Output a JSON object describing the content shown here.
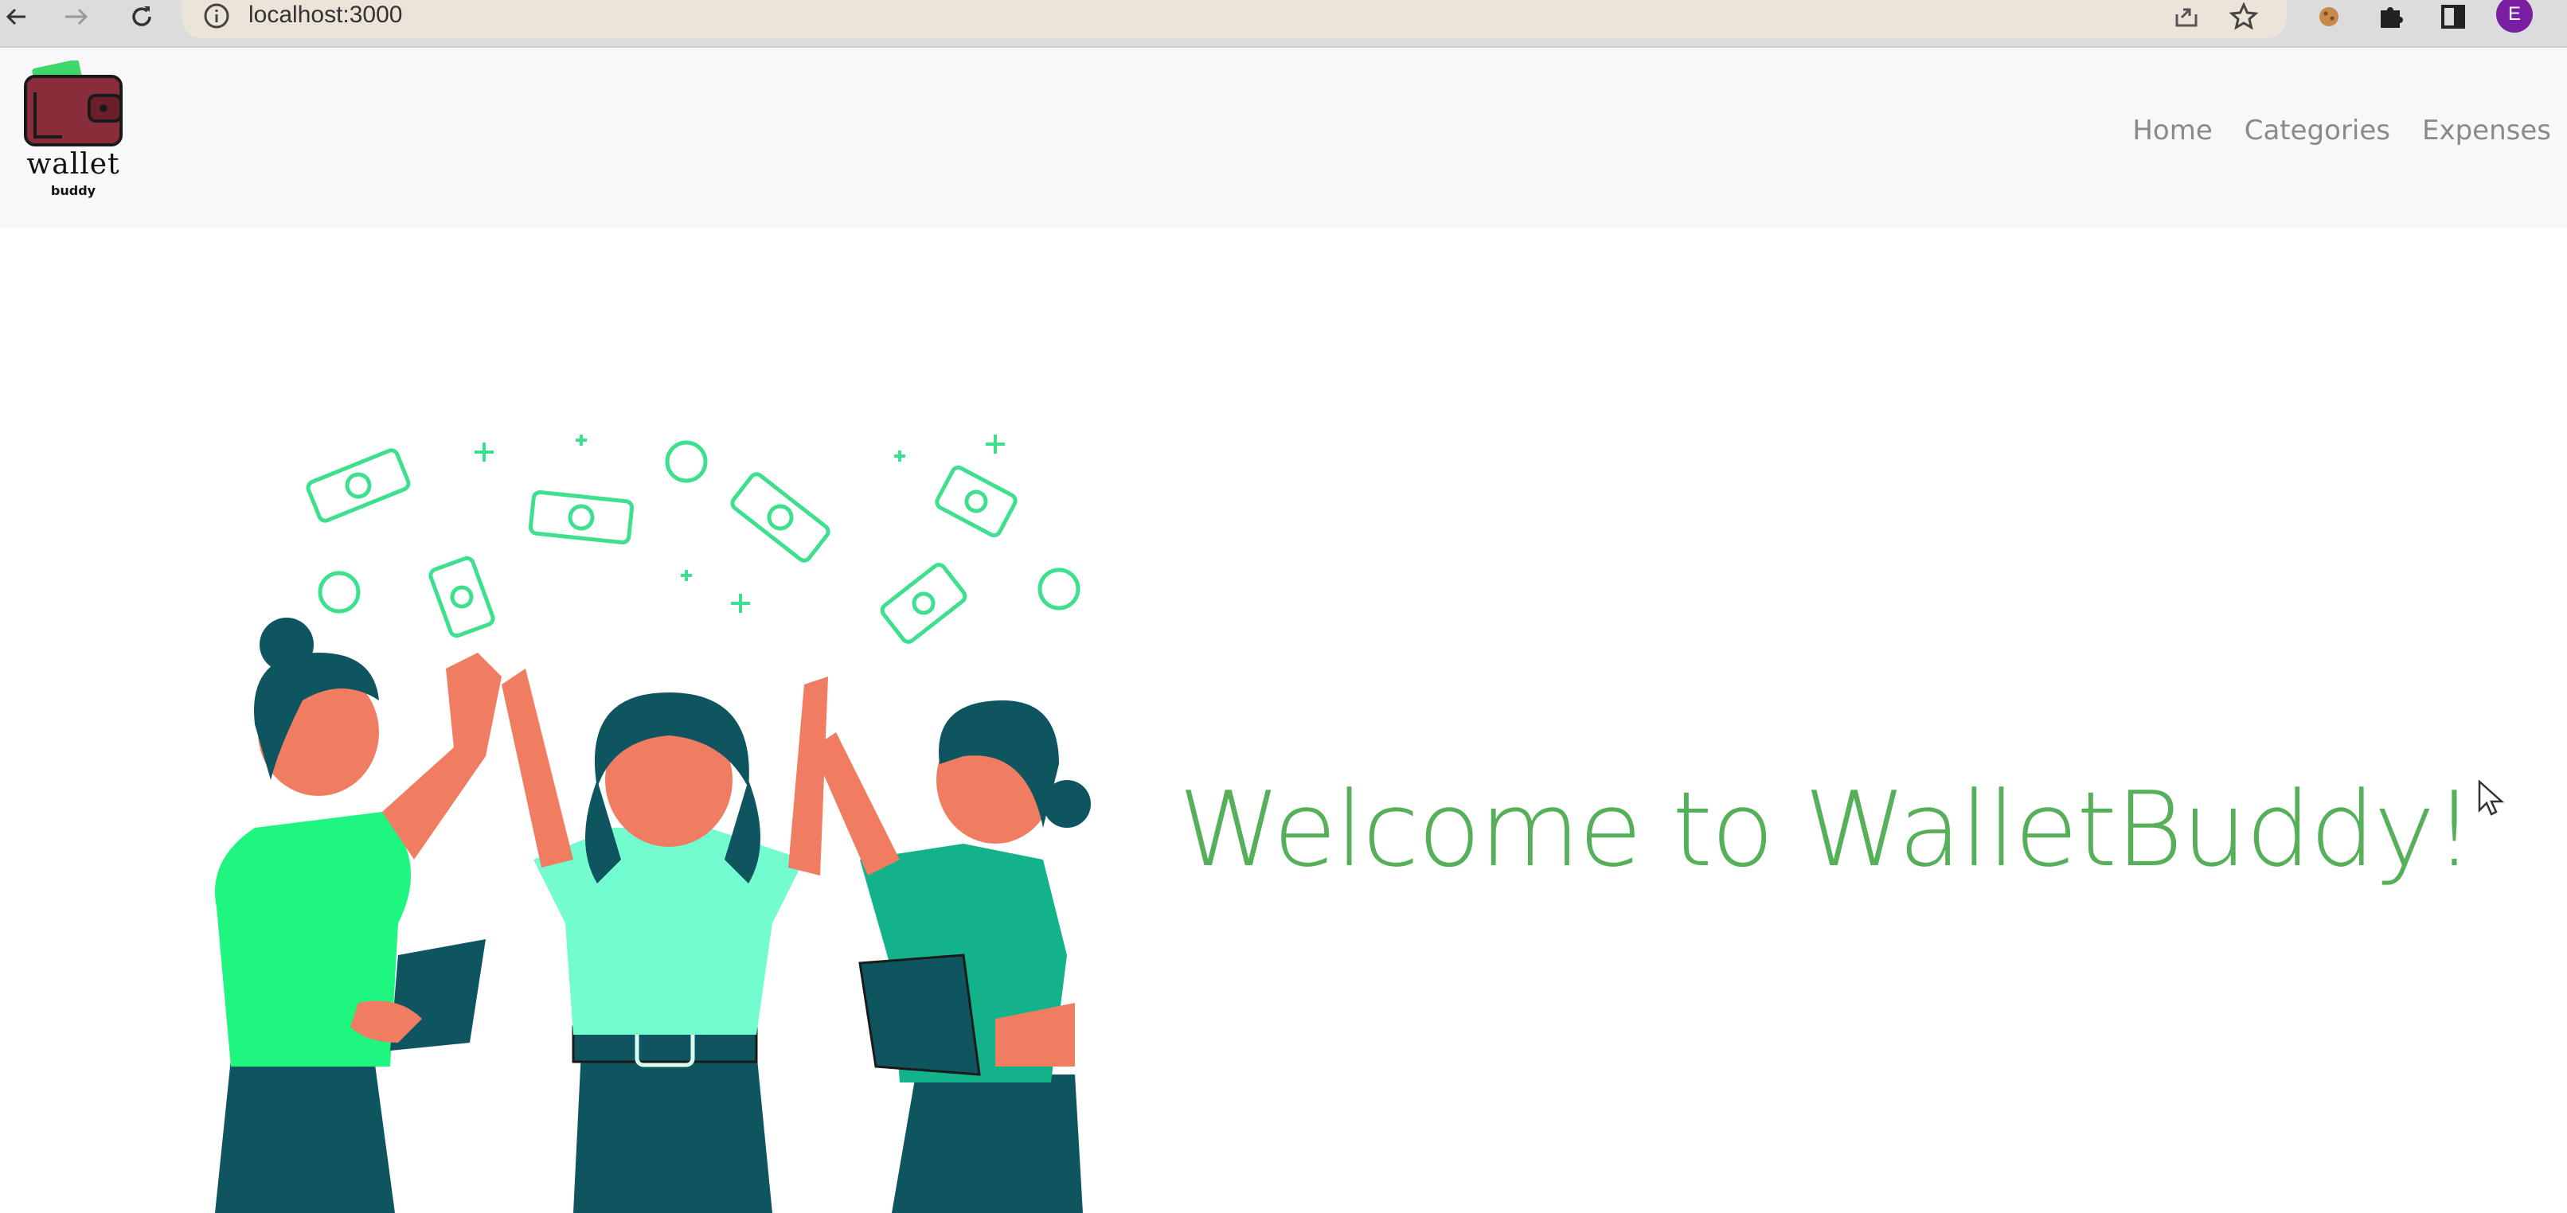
{
  "browser": {
    "url": "localhost:3000",
    "profile_initial": "E",
    "icons": [
      "back-icon",
      "forward-icon",
      "reload-icon",
      "info-icon",
      "share-icon",
      "star-icon",
      "extension-cookie-icon",
      "puzzle-icon",
      "sidepanel-icon"
    ]
  },
  "navbar": {
    "logo_title": "wallet",
    "logo_sub": "buddy",
    "links": [
      "Home",
      "Categories",
      "Expenses"
    ]
  },
  "main": {
    "welcome": "Welcome to WalletBuddy!"
  },
  "colors": {
    "accent_green": "#56b05a",
    "money_green": "#3ee08f",
    "dark_teal": "#0f5560",
    "skin": "#f07c62"
  }
}
